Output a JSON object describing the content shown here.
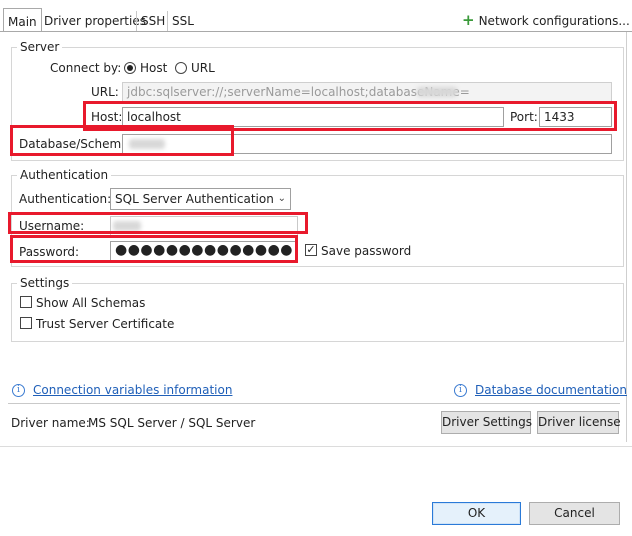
{
  "tabs": [
    "Main",
    "Driver properties",
    "SSH",
    "SSL"
  ],
  "network_config_label": "Network configurations...",
  "server": {
    "group_label": "Server",
    "connect_by_label": "Connect by:",
    "option_host": "Host",
    "option_url": "URL",
    "selected": "Host",
    "url_label": "URL:",
    "url_value": "jdbc:sqlserver://;serverName=localhost;databaseName=",
    "host_label": "Host:",
    "host_value": "localhost",
    "port_label": "Port:",
    "port_value": "1433",
    "database_label": "Database/Schema:"
  },
  "auth": {
    "group_label": "Authentication",
    "auth_label": "Authentication:",
    "auth_value": "SQL Server Authentication",
    "username_label": "Username:",
    "password_label": "Password:",
    "password_value": "●●●●●●●●●●●●●●",
    "save_password_label": "Save password",
    "save_password_checked": true
  },
  "settings": {
    "group_label": "Settings",
    "show_all_schemas": "Show All Schemas",
    "trust_server_certificate": "Trust Server Certificate"
  },
  "links": {
    "connection_variables": "Connection variables information",
    "database_documentation": "Database documentation"
  },
  "driver": {
    "label": "Driver name:",
    "value": "MS SQL Server / SQL Server",
    "settings_button": "Driver Settings",
    "license_button": "Driver license"
  },
  "dialog": {
    "ok": "OK",
    "cancel": "Cancel"
  },
  "colors": {
    "highlight": "#e8192c",
    "link": "#1f5fb8",
    "plus_icon": "#3a9a3a"
  }
}
